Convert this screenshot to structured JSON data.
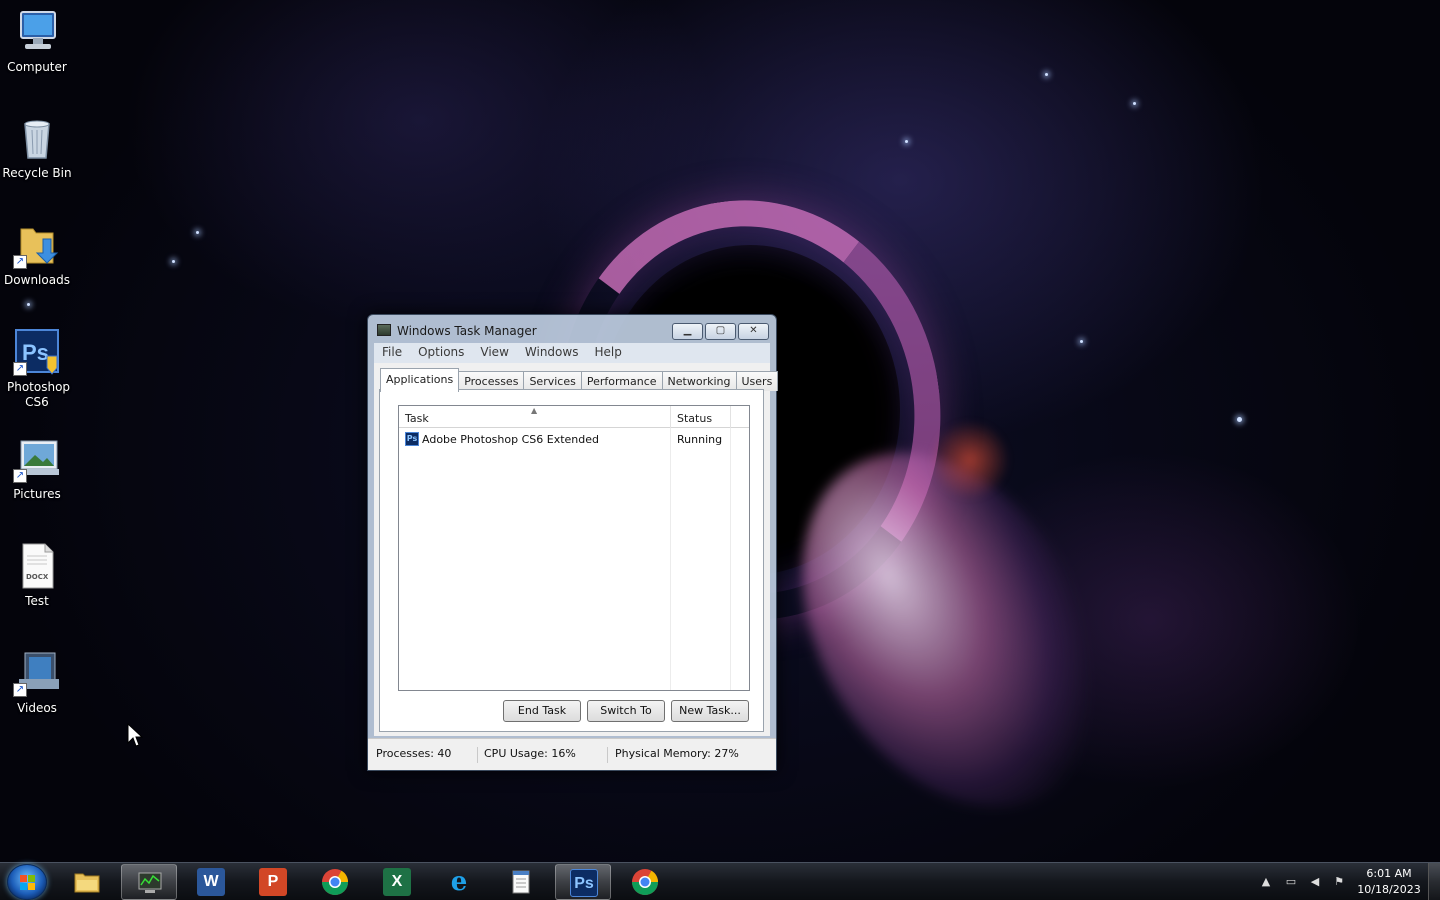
{
  "desktop": {
    "icons": [
      {
        "label": "Computer",
        "icon": "computer-icon"
      },
      {
        "label": "Recycle Bin",
        "icon": "recycle-bin-icon"
      },
      {
        "label": "Downloads",
        "icon": "folder-downloads-icon"
      },
      {
        "label": "Photoshop CS6",
        "icon": "photoshop-icon"
      },
      {
        "label": "Pictures",
        "icon": "pictures-icon"
      },
      {
        "label": "Test",
        "icon": "docx-file-icon",
        "badge": "DOCX"
      },
      {
        "label": "Videos",
        "icon": "videos-icon"
      }
    ]
  },
  "task_manager": {
    "title": "Windows Task Manager",
    "caption_buttons": {
      "minimize": "minimize",
      "maximize": "maximize",
      "close": "close"
    },
    "menu": [
      "File",
      "Options",
      "View",
      "Windows",
      "Help"
    ],
    "tabs": [
      "Applications",
      "Processes",
      "Services",
      "Performance",
      "Networking",
      "Users"
    ],
    "active_tab": "Applications",
    "columns": {
      "task": "Task",
      "status": "Status"
    },
    "rows": [
      {
        "task": "Adobe Photoshop CS6 Extended",
        "status": "Running",
        "icon": "photoshop-icon",
        "icon_text": "Ps"
      }
    ],
    "buttons": {
      "end_task": "End Task",
      "switch_to": "Switch To",
      "new_task": "New Task..."
    },
    "status": {
      "processes": "Processes: 40",
      "cpu": "CPU Usage: 16%",
      "memory": "Physical Memory: 27%"
    }
  },
  "taskbar": {
    "pinned": [
      {
        "name": "explorer",
        "icon": "folder-icon"
      },
      {
        "name": "task-manager",
        "icon": "task-manager-icon"
      },
      {
        "name": "word",
        "icon": "word-icon",
        "glyph": "W"
      },
      {
        "name": "powerpoint",
        "icon": "powerpoint-icon",
        "glyph": "P"
      },
      {
        "name": "chrome",
        "icon": "chrome-icon"
      },
      {
        "name": "excel",
        "icon": "excel-icon",
        "glyph": "X"
      },
      {
        "name": "internet-explorer",
        "icon": "ie-icon",
        "glyph": "e"
      },
      {
        "name": "notepad",
        "icon": "notepad-icon"
      },
      {
        "name": "photoshop",
        "icon": "photoshop-icon",
        "glyph": "Ps"
      },
      {
        "name": "chrome-2",
        "icon": "chrome-icon"
      }
    ],
    "clock": {
      "time": "6:01 AM",
      "date": "10/18/2023"
    },
    "colors": {
      "word": "#2b579a",
      "powerpoint": "#d24726",
      "excel": "#1e7145",
      "photoshop": "#0c2c63",
      "ie": "#1ea0e8"
    }
  }
}
